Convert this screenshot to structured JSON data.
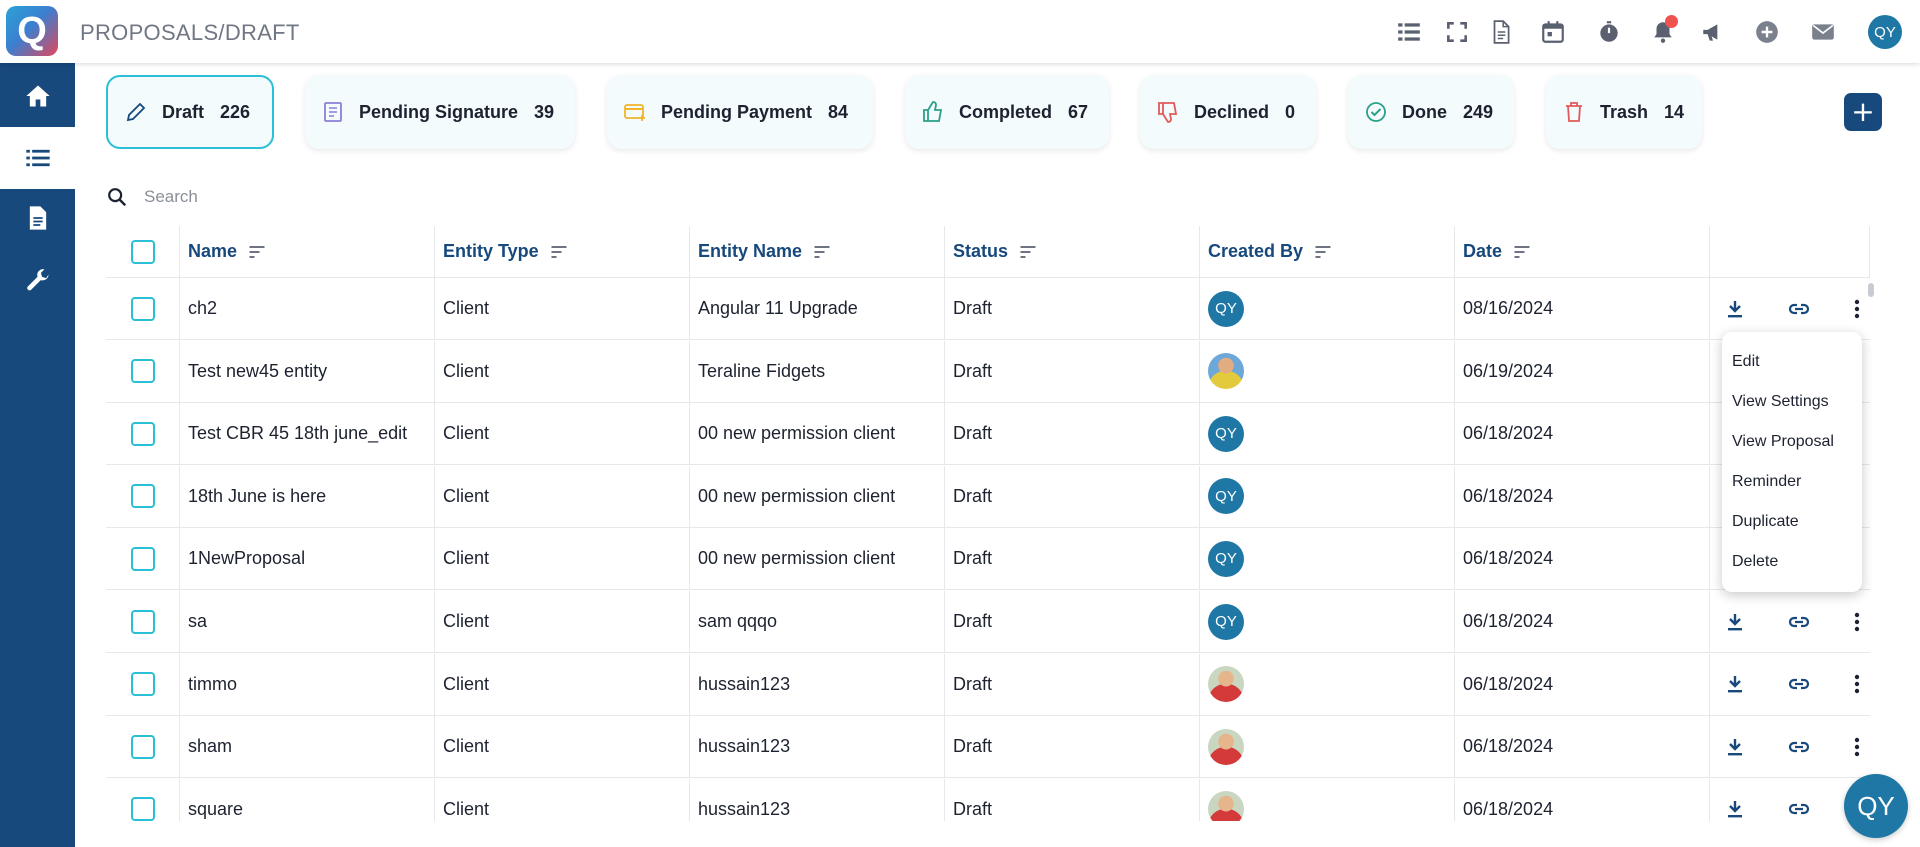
{
  "app": {
    "logo_letter": "Q",
    "page_title": "PROPOSALS/DRAFT",
    "user_initials": "QY"
  },
  "topbar_icons": [
    "list-view-icon",
    "fullscreen-icon",
    "document-icon",
    "calendar-icon",
    "timer-icon",
    "notification-bell-icon",
    "megaphone-icon",
    "add-circle-icon",
    "mail-icon"
  ],
  "sidebar": {
    "items": [
      "home-icon",
      "list-icon",
      "document-icon",
      "wrench-icon"
    ],
    "active": "list-icon"
  },
  "tabs": [
    {
      "label": "Draft",
      "count": "226",
      "icon": "pencil-icon",
      "icon_color": "#17497d",
      "active": true
    },
    {
      "label": "Pending Signature",
      "count": "39",
      "icon": "signature-doc-icon",
      "icon_color": "#8a7fd6"
    },
    {
      "label": "Pending Payment",
      "count": "84",
      "icon": "payment-card-icon",
      "icon_color": "#f0b429"
    },
    {
      "label": "Completed",
      "count": "67",
      "icon": "thumbs-up-icon",
      "icon_color": "#2aa08a"
    },
    {
      "label": "Declined",
      "count": "0",
      "icon": "thumbs-down-icon",
      "icon_color": "#e05a5a"
    },
    {
      "label": "Done",
      "count": "249",
      "icon": "check-circle-icon",
      "icon_color": "#2aa08a"
    },
    {
      "label": "Trash",
      "count": "14",
      "icon": "trash-icon",
      "icon_color": "#e05a5a"
    }
  ],
  "add_button": "+",
  "search": {
    "placeholder": "Search"
  },
  "table": {
    "columns": [
      "Name",
      "Entity Type",
      "Entity Name",
      "Status",
      "Created By",
      "Date"
    ],
    "rows": [
      {
        "name": "ch2",
        "entity_type": "Client",
        "entity_name": "Angular 11 Upgrade",
        "status": "Draft",
        "created_by": "QY",
        "avatar": "initials",
        "date": "08/16/2024"
      },
      {
        "name": "Test new45 entity",
        "entity_type": "Client",
        "entity_name": "Teraline Fidgets",
        "status": "Draft",
        "created_by": "",
        "avatar": "photo2",
        "date": "06/19/2024"
      },
      {
        "name": "Test CBR 45 18th june_edit",
        "entity_type": "Client",
        "entity_name": "00 new permission client",
        "status": "Draft",
        "created_by": "QY",
        "avatar": "initials",
        "date": "06/18/2024"
      },
      {
        "name": "18th June is here",
        "entity_type": "Client",
        "entity_name": "00 new permission client",
        "status": "Draft",
        "created_by": "QY",
        "avatar": "initials",
        "date": "06/18/2024"
      },
      {
        "name": "1NewProposal",
        "entity_type": "Client",
        "entity_name": "00 new permission client",
        "status": "Draft",
        "created_by": "QY",
        "avatar": "initials",
        "date": "06/18/2024"
      },
      {
        "name": "sa",
        "entity_type": "Client",
        "entity_name": "sam qqqo",
        "status": "Draft",
        "created_by": "QY",
        "avatar": "initials",
        "date": "06/18/2024"
      },
      {
        "name": "timmo",
        "entity_type": "Client",
        "entity_name": "hussain123",
        "status": "Draft",
        "created_by": "",
        "avatar": "photo",
        "date": "06/18/2024"
      },
      {
        "name": "sham",
        "entity_type": "Client",
        "entity_name": "hussain123",
        "status": "Draft",
        "created_by": "",
        "avatar": "photo",
        "date": "06/18/2024"
      },
      {
        "name": "square",
        "entity_type": "Client",
        "entity_name": "hussain123",
        "status": "Draft",
        "created_by": "",
        "avatar": "photo",
        "date": "06/18/2024"
      }
    ]
  },
  "context_menu": {
    "items": [
      "Edit",
      "View Settings",
      "View Proposal",
      "Reminder",
      "Duplicate",
      "Delete"
    ]
  },
  "floating_avatar": "QY"
}
